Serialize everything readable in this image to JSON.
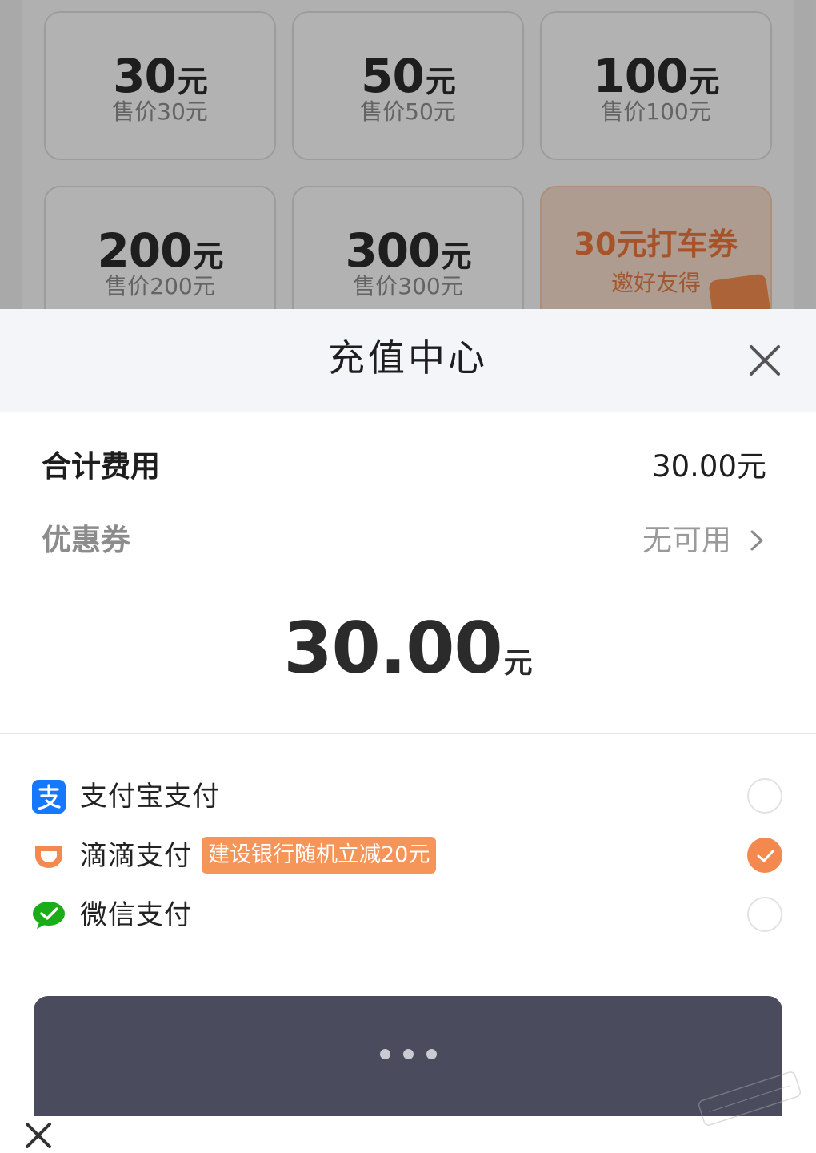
{
  "background": {
    "cards": [
      {
        "amount": "30",
        "unit": "元",
        "price": "售价30元"
      },
      {
        "amount": "50",
        "unit": "元",
        "price": "售价50元"
      },
      {
        "amount": "100",
        "unit": "元",
        "price": "售价100元"
      },
      {
        "amount": "200",
        "unit": "元",
        "price": "售价200元"
      },
      {
        "amount": "300",
        "unit": "元",
        "price": "售价300元"
      }
    ],
    "promo_card": {
      "title": "30元打车券",
      "subtitle": "邀好友得"
    }
  },
  "sheet": {
    "title": "充值中心",
    "total": {
      "label": "合计费用",
      "value": "30.00元"
    },
    "coupon": {
      "label": "优惠券",
      "value": "无可用"
    },
    "amount": {
      "number": "30.00",
      "unit": "元"
    }
  },
  "payment": {
    "methods": [
      {
        "name": "支付宝支付",
        "icon": "alipay-icon",
        "selected": false
      },
      {
        "name": "滴滴支付",
        "icon": "didi-icon",
        "badge": "建设银行随机立减20元",
        "selected": true
      },
      {
        "name": "微信支付",
        "icon": "wechat-icon",
        "selected": false
      }
    ]
  },
  "pay_button": {
    "state": "loading"
  },
  "colors": {
    "accent": "#f4894f",
    "button": "#4a4b5c",
    "alipay": "#1677ff",
    "wechat": "#1aad19"
  }
}
